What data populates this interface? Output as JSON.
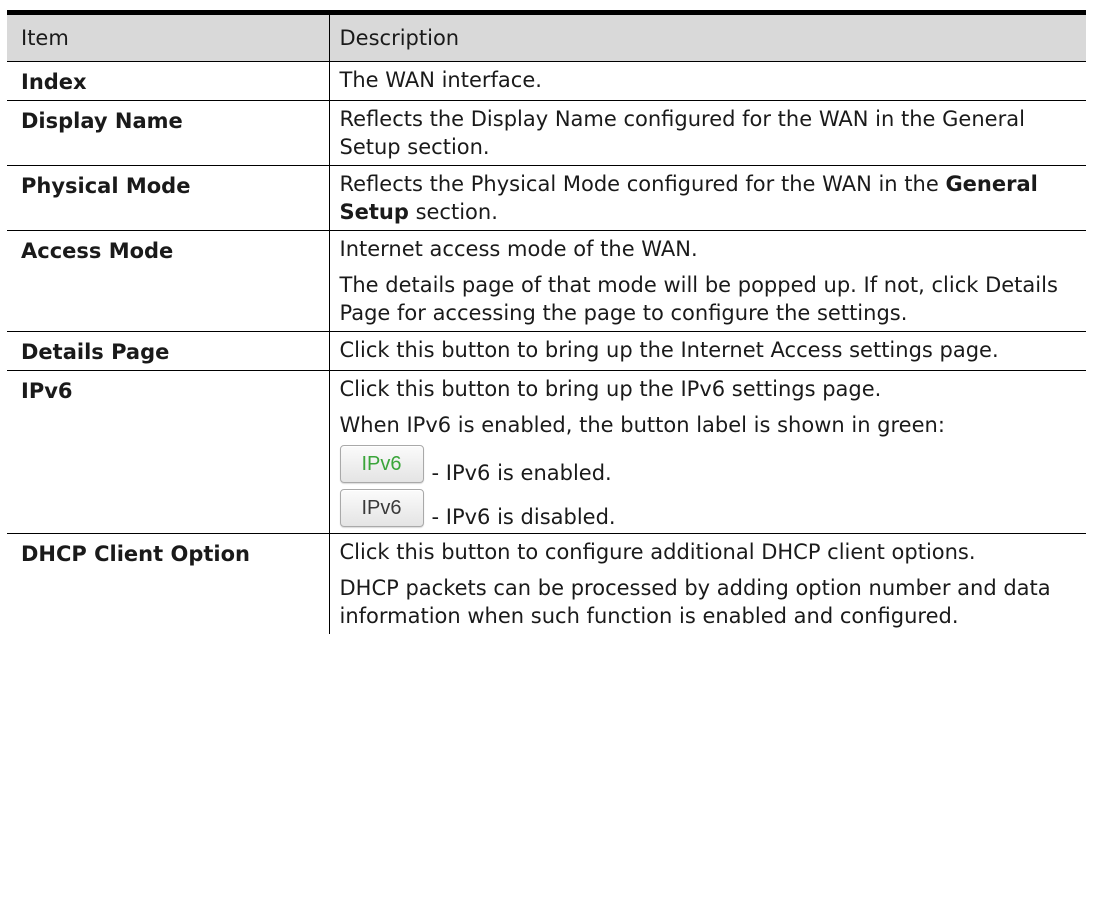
{
  "table": {
    "header": {
      "item": "Item",
      "description": "Description"
    },
    "rows": {
      "index": {
        "item": "Index",
        "desc": "The WAN interface."
      },
      "display_name": {
        "item": "Display Name",
        "desc": "Reflects the Display Name configured for the WAN in the General Setup section."
      },
      "physical_mode": {
        "item": "Physical Mode",
        "desc_pre": "Reflects the Physical Mode configured for the WAN in the ",
        "desc_bold": "General Setup",
        "desc_post": " section."
      },
      "access_mode": {
        "item": "Access Mode",
        "desc1": "Internet access mode of the WAN.",
        "desc2": "The details page of that mode will be popped up. If not, click Details Page for accessing the page to configure the settings."
      },
      "details_page": {
        "item": "Details Page",
        "desc": "Click this button to bring up the Internet Access settings page."
      },
      "ipv6": {
        "item": "IPv6",
        "desc1": "Click this button to bring up the IPv6 settings page.",
        "desc2": "When IPv6 is enabled, the button label is shown in green:",
        "enabled_button_label": "IPv6",
        "enabled_caption": "- IPv6 is enabled.",
        "disabled_button_label": "IPv6",
        "disabled_caption": "- IPv6 is disabled.",
        "enabled_label_color": "#3aa53a"
      },
      "dhcp_client_option": {
        "item": "DHCP Client Option",
        "desc1": "Click this button to configure additional DHCP client options.",
        "desc2": "DHCP packets can be processed by adding option number and data information when such function is enabled and configured."
      }
    }
  }
}
